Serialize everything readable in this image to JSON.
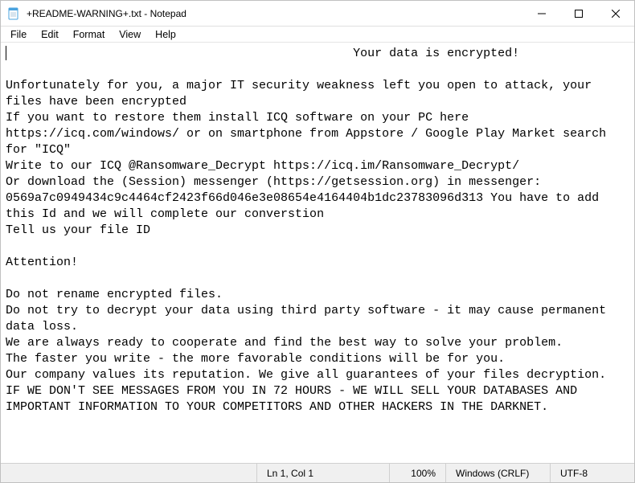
{
  "window": {
    "title": "+README-WARNING+.txt - Notepad"
  },
  "menubar": {
    "file": "File",
    "edit": "Edit",
    "format": "Format",
    "view": "View",
    "help": "Help"
  },
  "document_text": "                                                Your data is encrypted!\n\nUnfortunately for you, a major IT security weakness left you open to attack, your files have been encrypted\nIf you want to restore them install ICQ software on your PC here https://icq.com/windows/ or on smartphone from Appstore / Google Play Market search for \"ICQ\"\nWrite to our ICQ @Ransomware_Decrypt https://icq.im/Ransomware_Decrypt/\nOr download the (Session) messenger (https://getsession.org) in messenger: 0569a7c0949434c9c4464cf2423f66d046e3e08654e4164404b1dc23783096d313 You have to add this Id and we will complete our converstion\nTell us your file ID\n\nAttention!\n\nDo not rename encrypted files.\nDo not try to decrypt your data using third party software - it may cause permanent data loss.\nWe are always ready to cooperate and find the best way to solve your problem.\nThe faster you write - the more favorable conditions will be for you.\nOur company values its reputation. We give all guarantees of your files decryption.\nIF WE DON'T SEE MESSAGES FROM YOU IN 72 HOURS - WE WILL SELL YOUR DATABASES AND IMPORTANT INFORMATION TO YOUR COMPETITORS AND OTHER HACKERS IN THE DARKNET.",
  "statusbar": {
    "position": "Ln 1, Col 1",
    "zoom": "100%",
    "line_ending": "Windows (CRLF)",
    "encoding": "UTF-8"
  }
}
